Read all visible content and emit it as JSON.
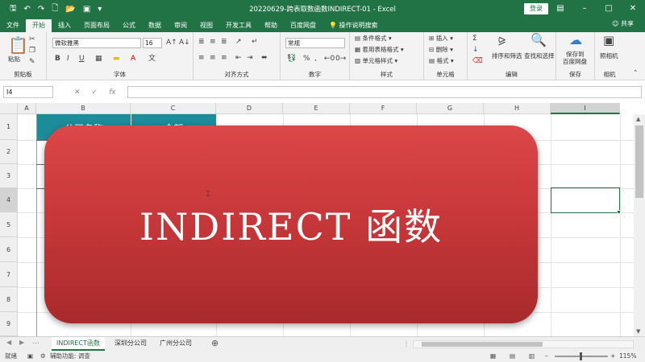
{
  "titlebar": {
    "title": "20220629-跨表取数函数INDIRECT-01  -  Excel",
    "login": "登录",
    "qa_icons": [
      "save-icon",
      "undo-icon",
      "redo-icon",
      "new-file-icon",
      "open-file-icon",
      "camera-icon",
      "customize-icon"
    ]
  },
  "tabs": [
    "文件",
    "开始",
    "插入",
    "页面布局",
    "公式",
    "数据",
    "审阅",
    "视图",
    "开发工具",
    "帮助",
    "百度网盘",
    "操作说明搜索"
  ],
  "share": "共享",
  "ribbon": {
    "clipboard": {
      "paste": "粘贴",
      "label": "剪贴板"
    },
    "font": {
      "name": "微软雅黑",
      "size": "16",
      "label": "字体"
    },
    "align": {
      "label": "对齐方式"
    },
    "number": {
      "format": "常规",
      "label": "数字"
    },
    "styles": {
      "cond": "条件格式",
      "table": "套用表格格式",
      "cell": "单元格样式",
      "label": "样式"
    },
    "cells": {
      "insert": "插入",
      "delete": "删除",
      "format": "格式",
      "label": "单元格"
    },
    "edit": {
      "sort": "排序和筛选",
      "find": "查找和选择",
      "label": "编辑"
    },
    "save": {
      "text1": "保存到",
      "text2": "百度网盘",
      "label": "保存"
    },
    "camera": {
      "text": "照相机",
      "label": "相机"
    }
  },
  "formula_bar": {
    "namebox": "I4",
    "fx": "fx"
  },
  "columns": [
    "A",
    "B",
    "C",
    "D",
    "E",
    "F",
    "G",
    "H",
    "I"
  ],
  "rows": [
    "1",
    "2",
    "3",
    "4",
    "5",
    "6",
    "7",
    "8",
    "9"
  ],
  "cells": {
    "b1": "公司名称",
    "c1": "金额"
  },
  "overlay_text": "INDIRECT 函数",
  "sheets": [
    "INDIRECT函数",
    "深圳分公司",
    "广州分公司"
  ],
  "status": {
    "ready": "就绪",
    "accessibility": "辅助功能: 调查",
    "zoom": "115%"
  },
  "colors": {
    "excel_green": "#217346",
    "header_teal": "#1c8b9a",
    "overlay_red": "#c8383a"
  }
}
